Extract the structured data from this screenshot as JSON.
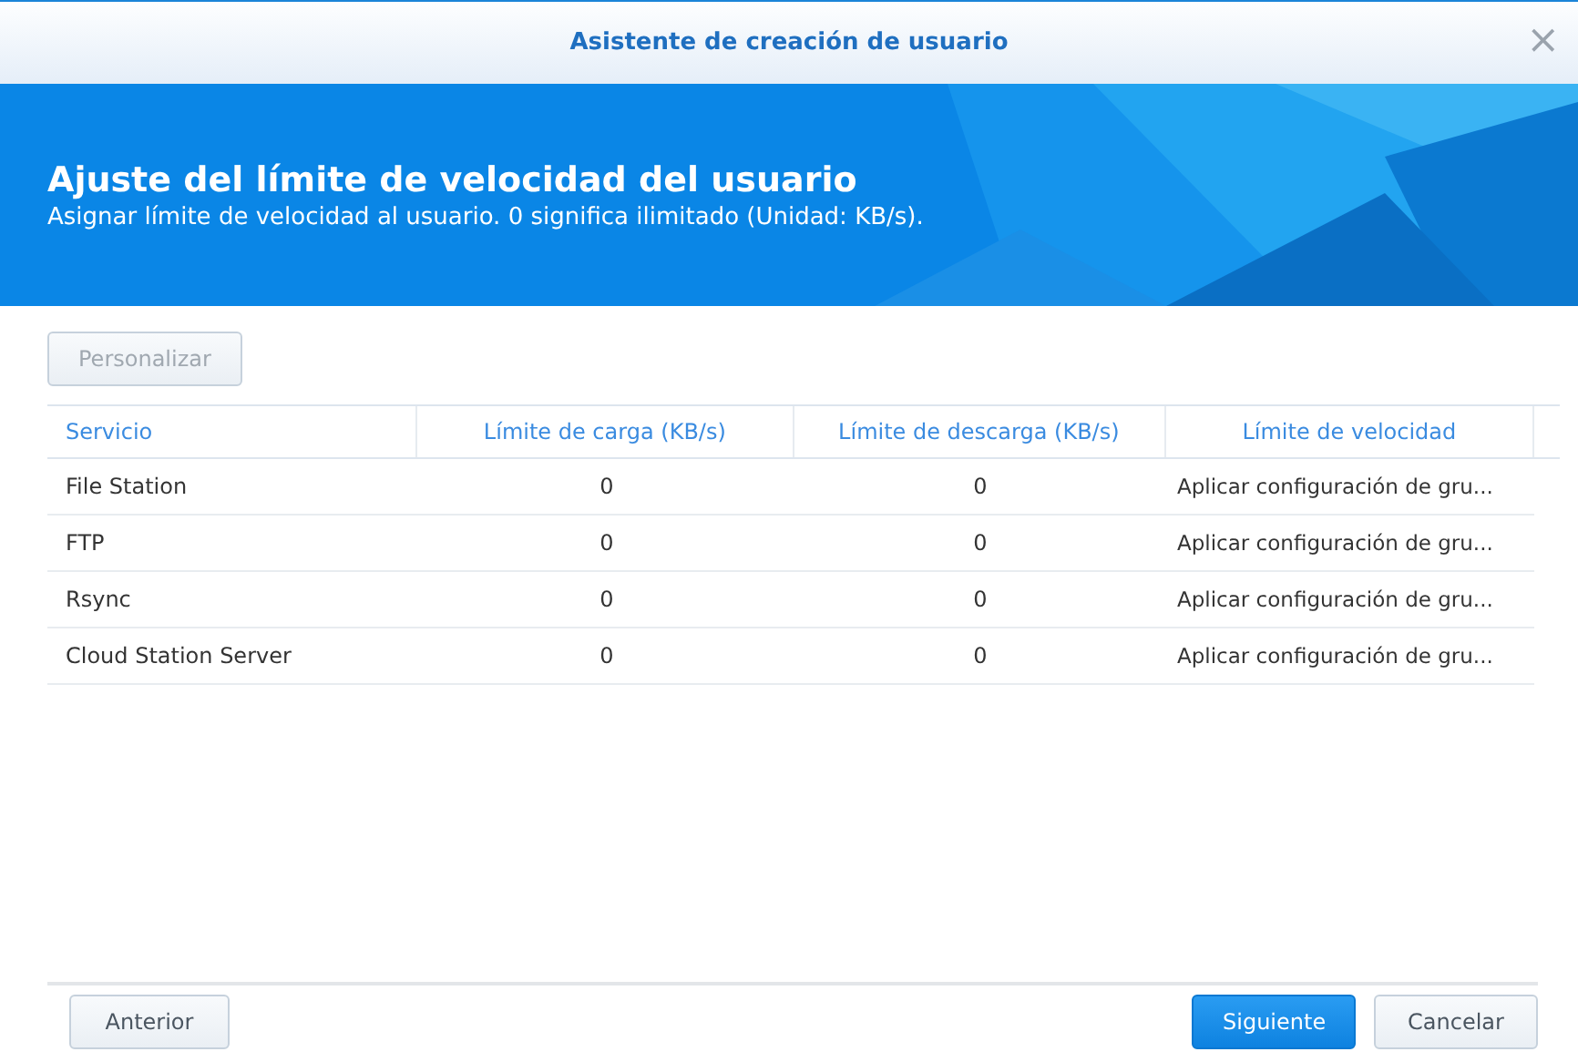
{
  "window": {
    "title": "Asistente de creación de usuario",
    "close": "×"
  },
  "banner": {
    "title": "Ajuste del límite de velocidad del usuario",
    "subtitle": "Asignar límite de velocidad al usuario. 0 significa ilimitado (Unidad: KB/s)."
  },
  "toolbar": {
    "button": {
      "label": "Personalizar",
      "disabled": true
    }
  },
  "table": {
    "columns": [
      "Servicio",
      "Límite de carga (KB/s)",
      "Límite de descarga (KB/s)",
      "Límite de velocidad"
    ],
    "rows": [
      [
        "File Station",
        "0",
        "0",
        "Aplicar configuración de gru..."
      ],
      [
        "FTP",
        "0",
        "0",
        "Aplicar configuración de gru..."
      ],
      [
        "Rsync",
        "0",
        "0",
        "Aplicar configuración de gru..."
      ],
      [
        "Cloud Station Server",
        "0",
        "0",
        "Aplicar configuración de gru..."
      ]
    ]
  },
  "footer": {
    "left_buttons": [
      {
        "label": "Anterior",
        "kind": "secondary"
      }
    ],
    "right_buttons": [
      {
        "label": "Siguiente",
        "kind": "primary"
      },
      {
        "label": "Cancelar",
        "kind": "secondary"
      }
    ]
  }
}
